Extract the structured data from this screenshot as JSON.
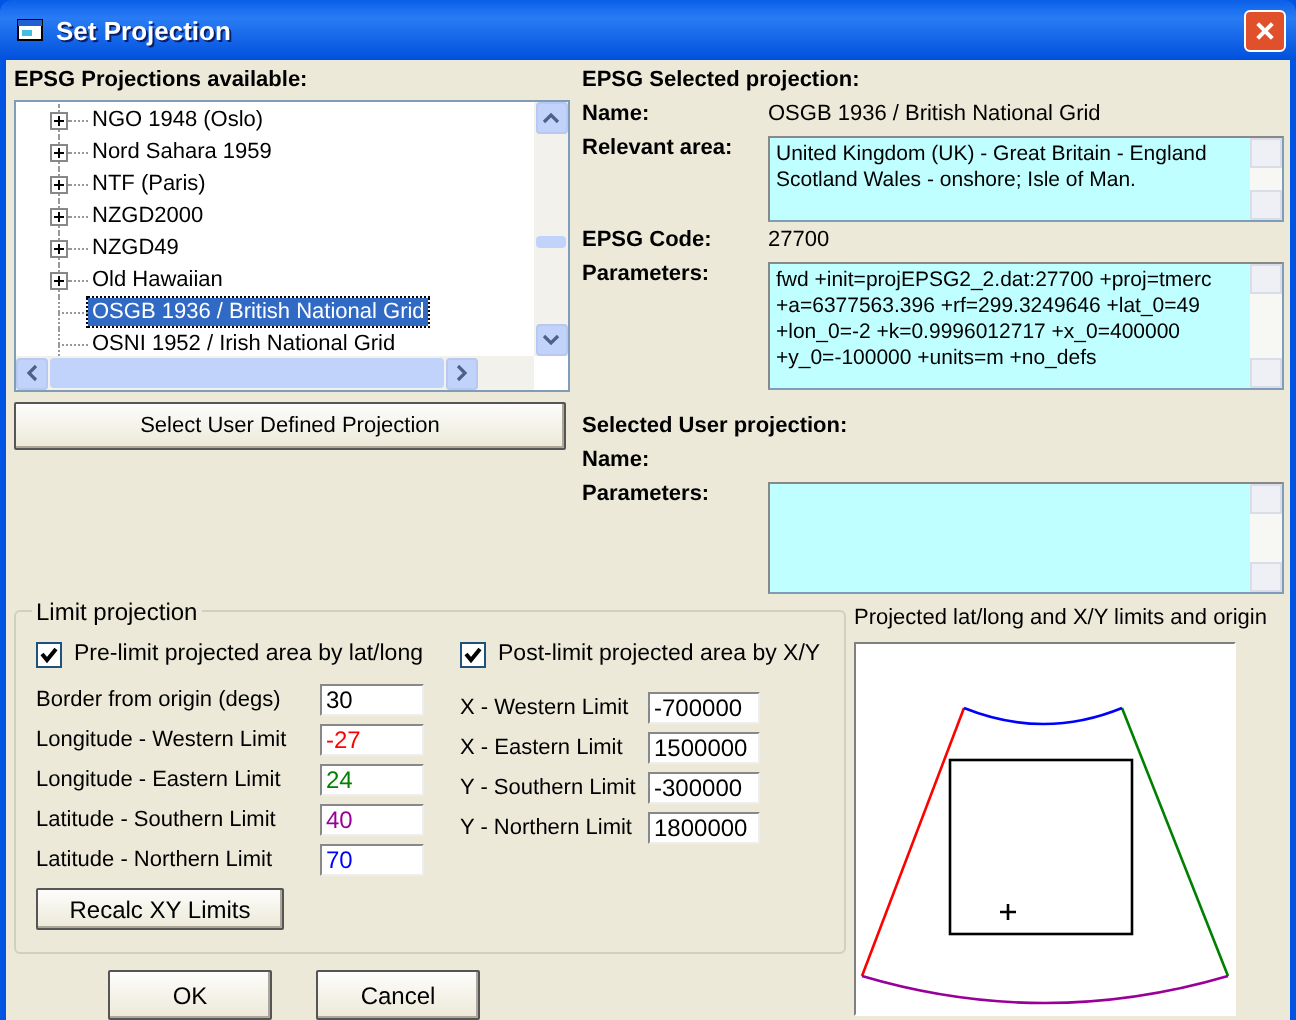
{
  "window": {
    "title": "Set Projection"
  },
  "available": {
    "label": "EPSG Projections available:",
    "items": [
      {
        "label": "NGO 1948 (Oslo)",
        "expandable": true,
        "selected": false
      },
      {
        "label": "Nord Sahara 1959",
        "expandable": true,
        "selected": false
      },
      {
        "label": "NTF (Paris)",
        "expandable": true,
        "selected": false
      },
      {
        "label": "NZGD2000",
        "expandable": true,
        "selected": false
      },
      {
        "label": "NZGD49",
        "expandable": true,
        "selected": false
      },
      {
        "label": "Old Hawaiian",
        "expandable": true,
        "selected": false
      },
      {
        "label": "OSGB 1936 / British National Grid",
        "expandable": false,
        "selected": true
      },
      {
        "label": "OSNI 1952 / Irish National Grid",
        "expandable": false,
        "selected": false
      }
    ]
  },
  "user_defined_button": "Select User Defined Projection",
  "selected_projection": {
    "heading": "EPSG Selected projection:",
    "name_label": "Name:",
    "name": "OSGB 1936 / British National Grid",
    "area_label": "Relevant area:",
    "area": "United Kingdom (UK) - Great Britain - England Scotland  Wales - onshore; Isle of Man.",
    "code_label": "EPSG Code:",
    "code": "27700",
    "parameters_label": "Parameters:",
    "parameters": "fwd +init=projEPSG2_2.dat:27700 +proj=tmerc +a=6377563.396 +rf=299.3249646 +lat_0=49 +lon_0=-2 +k=0.9996012717 +x_0=400000 +y_0=-100000 +units=m +no_defs"
  },
  "user_projection": {
    "heading": "Selected User projection:",
    "name_label": "Name:",
    "parameters_label": "Parameters:"
  },
  "limits": {
    "title": "Limit projection",
    "pre": {
      "label": "Pre-limit projected area by lat/long",
      "checked": true
    },
    "post": {
      "label": "Post-limit projected area by X/Y",
      "checked": true
    },
    "latlong": [
      {
        "label": "Border from origin (degs)",
        "value": "30"
      },
      {
        "label": "Longitude - Western Limit",
        "value": "-27",
        "color": "#ff0000"
      },
      {
        "label": "Longitude - Eastern Limit",
        "value": "24",
        "color": "#008000"
      },
      {
        "label": "Latitude - Southern Limit",
        "value": "40",
        "color": "#990099"
      },
      {
        "label": "Latitude - Northern Limit",
        "value": "70",
        "color": "#0000ff"
      }
    ],
    "xy": [
      {
        "label": "X - Western Limit",
        "value": "-700000"
      },
      {
        "label": "X - Eastern Limit",
        "value": "1500000"
      },
      {
        "label": "Y - Southern Limit",
        "value": "-300000"
      },
      {
        "label": "Y - Northern Limit",
        "value": "1800000"
      }
    ],
    "recalc_button": "Recalc XY Limits"
  },
  "preview": {
    "label": "Projected lat/long and X/Y limits and origin"
  },
  "buttons": [
    "OK",
    "Cancel"
  ]
}
